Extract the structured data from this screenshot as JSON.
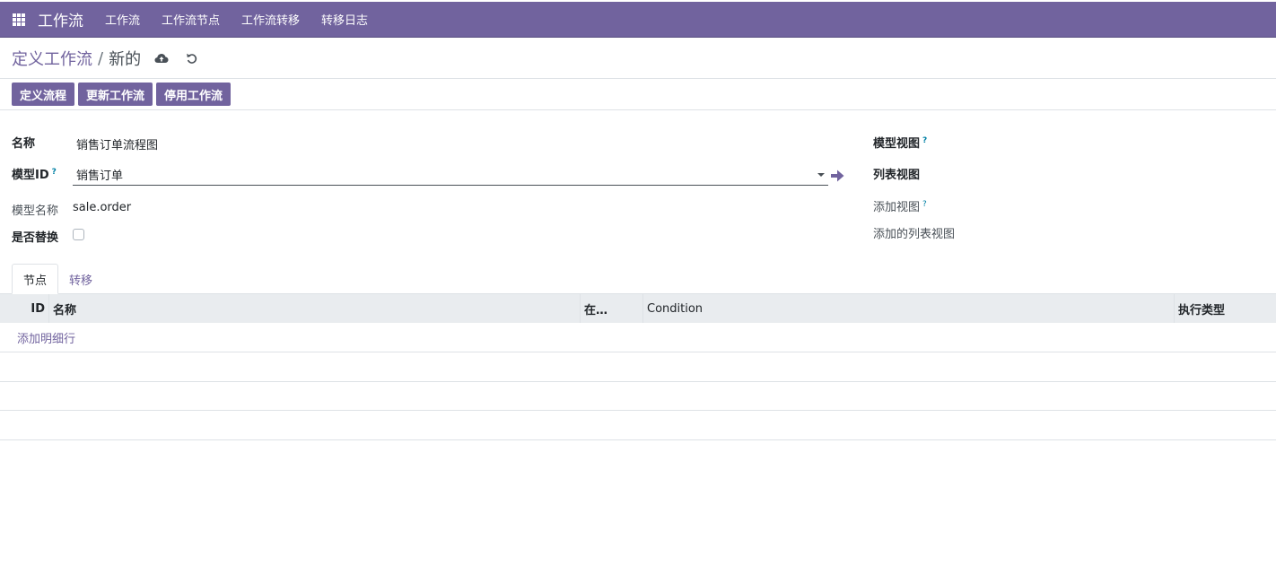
{
  "navbar": {
    "app_title": "工作流",
    "menu": [
      "工作流",
      "工作流节点",
      "工作流转移",
      "转移日志"
    ]
  },
  "breadcrumb": {
    "parent": "定义工作流",
    "separator": "/",
    "current": "新的"
  },
  "actions": {
    "save_icon": "cloud-upload-icon",
    "discard_icon": "undo-icon"
  },
  "header_buttons": [
    "定义流程",
    "更新工作流",
    "停用工作流"
  ],
  "form": {
    "name_label": "名称",
    "name_value": "销售订单流程图",
    "model_id_label": "模型ID",
    "model_id_value": "销售订单",
    "model_name_label": "模型名称",
    "model_name_value": "sale.order",
    "replace_label": "是否替换",
    "replace_checked": false,
    "help_mark": "?",
    "model_view_label": "模型视图",
    "list_view_label": "列表视图",
    "add_view_label": "添加视图",
    "add_list_view_label": "添加的列表视图"
  },
  "tabs": [
    "节点",
    "转移"
  ],
  "table": {
    "columns": [
      "ID",
      "名称",
      "在…",
      "Condition",
      "执行类型"
    ],
    "add_line": "添加明细行"
  },
  "colors": {
    "brand": "#71639e",
    "help": "#0180a5",
    "header_bg": "#e9ecef"
  }
}
